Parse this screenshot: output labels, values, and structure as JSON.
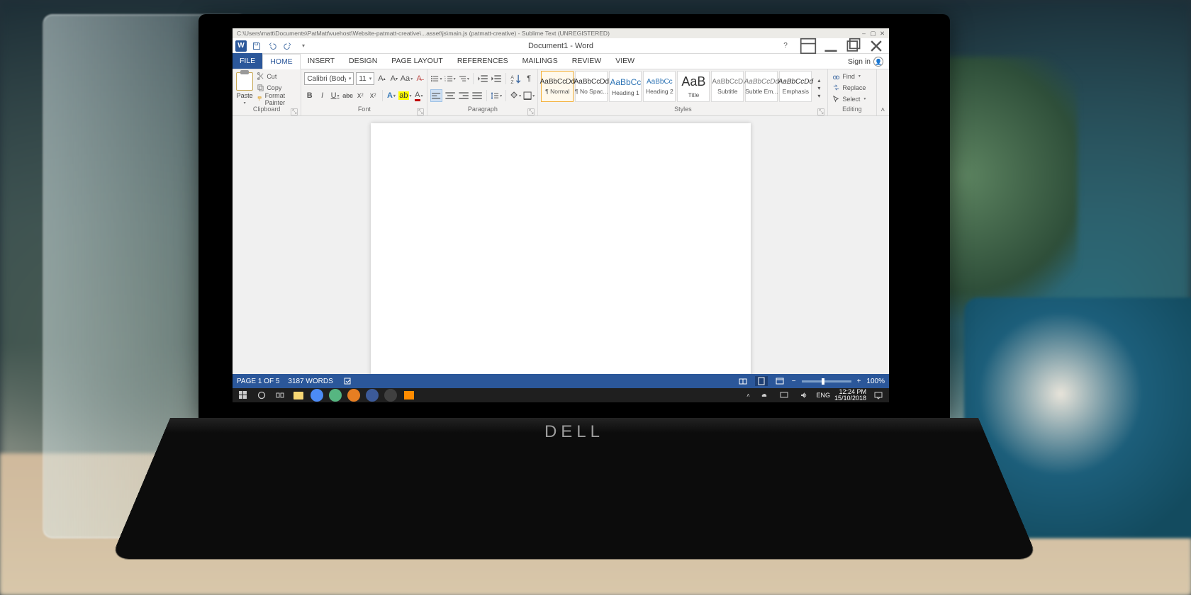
{
  "bg_window_title": "C:\\Users\\matt\\Documents\\PatMatt\\vuehost\\Website-patmatt-creative\\...asset\\js\\main.js (patmatt-creative) - Sublime Text (UNREGISTERED)",
  "title": "Document1 - Word",
  "qa": {
    "save": "Save",
    "undo": "Undo",
    "redo": "Redo"
  },
  "title_right": {
    "help": "?",
    "ribbon_opts": "Ribbon Display Options",
    "min": "Minimize",
    "max": "Restore",
    "close": "Close"
  },
  "tabs": {
    "file": "FILE",
    "list": [
      "HOME",
      "INSERT",
      "DESIGN",
      "PAGE LAYOUT",
      "REFERENCES",
      "MAILINGS",
      "REVIEW",
      "VIEW"
    ],
    "active": 0,
    "signin": "Sign in"
  },
  "ribbon": {
    "clipboard": {
      "label": "Clipboard",
      "paste": "Paste",
      "cut": "Cut",
      "copy": "Copy",
      "format_painter": "Format Painter"
    },
    "font": {
      "label": "Font",
      "name": "Calibri (Body)",
      "size": "11",
      "grow": "A▴",
      "shrink": "A▾",
      "case": "Aa",
      "clear": "Clear Formatting",
      "bold": "B",
      "italic": "I",
      "underline": "U",
      "strike": "abc",
      "sub": "x₂",
      "sup": "x²",
      "text_effects": "A",
      "highlight": "ab",
      "font_color": "A"
    },
    "paragraph": {
      "label": "Paragraph",
      "row1": [
        "Bullets",
        "Numbering",
        "Multilevel",
        "Decrease Indent",
        "Increase Indent",
        "Sort",
        "Show Marks"
      ],
      "row2": [
        "Align Left",
        "Center",
        "Align Right",
        "Justify",
        "Line Spacing",
        "Shading",
        "Borders"
      ]
    },
    "styles": {
      "label": "Styles",
      "items": [
        {
          "preview": "AaBbCcDd",
          "name": "¶ Normal"
        },
        {
          "preview": "AaBbCcDd",
          "name": "¶ No Spac..."
        },
        {
          "preview": "AaBbCc",
          "name": "Heading 1"
        },
        {
          "preview": "AaBbCc",
          "name": "Heading 2"
        },
        {
          "preview": "AaB",
          "name": "Title"
        },
        {
          "preview": "AaBbCcD",
          "name": "Subtitle"
        },
        {
          "preview": "AaBbCcDd",
          "name": "Subtle Em..."
        },
        {
          "preview": "AaBbCcDd",
          "name": "Emphasis"
        }
      ]
    },
    "editing": {
      "label": "Editing",
      "find": "Find",
      "replace": "Replace",
      "select": "Select"
    }
  },
  "collapse_ribbon": "Collapse the Ribbon",
  "status": {
    "page": "PAGE 1 OF 5",
    "words": "3187 WORDS",
    "zoom_minus": "−",
    "zoom_plus": "+",
    "zoom": "100%"
  },
  "taskbar": {
    "lang": "ENG",
    "time": "12:24 PM",
    "date": "15/10/2018"
  },
  "laptop_brand": "DELL"
}
